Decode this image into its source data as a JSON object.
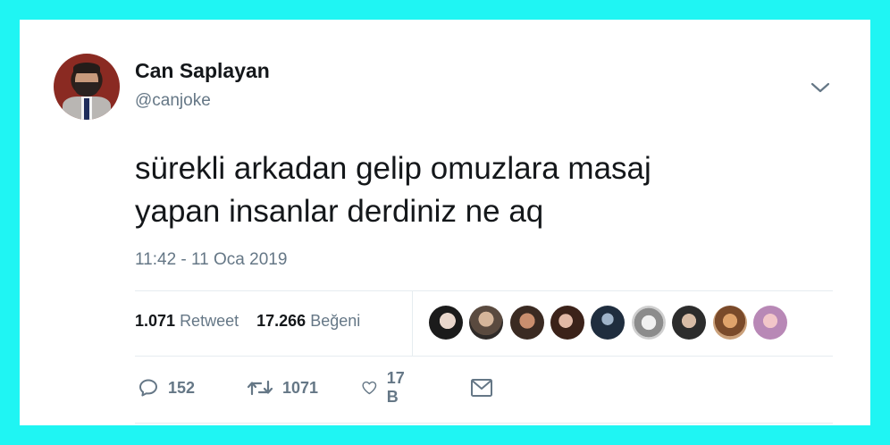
{
  "tweet": {
    "author_name": "Can Saplayan",
    "author_handle": "@canjoke",
    "text_line1": "sürekli arkadan gelip omuzlara masaj",
    "text_line2": "yapan insanlar derdiniz ne aq",
    "timestamp": "11:42 - 11 Oca 2019"
  },
  "stats": {
    "retweet_count": "1.071",
    "retweet_label": "Retweet",
    "like_count": "17.266",
    "like_label": "Beğeni"
  },
  "actions": {
    "reply_count": "152",
    "retweet_count": "1071",
    "like_count": "17 B"
  },
  "colors": {
    "frame": "#1ff5f3",
    "text": "#14171a",
    "secondary": "#657786",
    "divider": "#e6ecf0"
  },
  "icons": {
    "menu": "chevron-down-icon",
    "reply": "reply-icon",
    "retweet": "retweet-icon",
    "like": "heart-icon",
    "dm": "envelope-icon"
  },
  "likers_count_shown": 9
}
